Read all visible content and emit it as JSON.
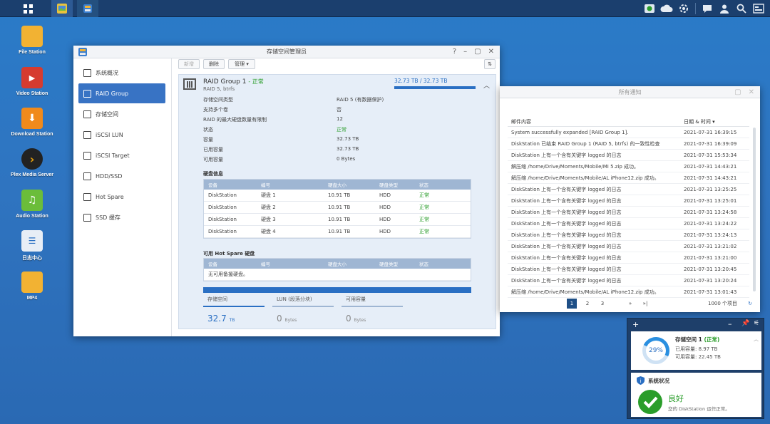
{
  "colors": {
    "accent": "#3873c4",
    "ok": "#2a9d2a",
    "taskbar": "#1b3f6e"
  },
  "desktop": [
    {
      "label": "File Station",
      "icon": "folder-icon",
      "color": "#f2b233"
    },
    {
      "label": "Video Station",
      "icon": "film-icon",
      "color": "#d63b2f"
    },
    {
      "label": "Download Station",
      "icon": "download-arrow-icon",
      "color": "#f08a1c"
    },
    {
      "label": "Plex Media Server",
      "icon": "plex-chevron-icon",
      "color": "#222222"
    },
    {
      "label": "Audio Station",
      "icon": "music-note-icon",
      "color": "#6bbd3a"
    },
    {
      "label": "日志中心",
      "icon": "log-document-icon",
      "color": "#e8eef6"
    },
    {
      "label": "MP4",
      "icon": "folder-icon",
      "color": "#f2b233"
    }
  ],
  "storage": {
    "title": "存储空间管理员",
    "sidebar": [
      "系统概况",
      "RAID Group",
      "存储空间",
      "iSCSI LUN",
      "iSCSI Target",
      "HDD/SSD",
      "Hot Spare",
      "SSD 缓存"
    ],
    "toolbar": {
      "new": "新增",
      "delete": "删除",
      "manage": "管理 ▾"
    },
    "raid": {
      "title": "RAID Group 1",
      "status": "- 正常",
      "sub": "RAID 5, btrfs",
      "capacity": "32.73 TB / 32.73 TB",
      "props": [
        {
          "k": "存储空间类型",
          "v": "RAID 5 (有数据保护)"
        },
        {
          "k": "支持多个卷",
          "v": "否"
        },
        {
          "k": "RAID 的最大硬盘数量有限制",
          "v": "12"
        },
        {
          "k": "状态",
          "v": "正常"
        },
        {
          "k": "容量",
          "v": "32.73 TB"
        },
        {
          "k": "已用容量",
          "v": "32.73 TB"
        },
        {
          "k": "可用容量",
          "v": "0 Bytes"
        }
      ]
    },
    "disk_info": {
      "title": "硬盘信息",
      "headers": [
        "设备",
        "编号",
        "硬盘大小",
        "硬盘类型",
        "状态"
      ],
      "rows": [
        [
          "DiskStation",
          "硬盘 1",
          "10.91 TB",
          "HDD",
          "正常"
        ],
        [
          "DiskStation",
          "硬盘 2",
          "10.91 TB",
          "HDD",
          "正常"
        ],
        [
          "DiskStation",
          "硬盘 3",
          "10.91 TB",
          "HDD",
          "正常"
        ],
        [
          "DiskStation",
          "硬盘 4",
          "10.91 TB",
          "HDD",
          "正常"
        ]
      ]
    },
    "hot_spare": {
      "title": "可用 Hot Spare 硬盘",
      "headers": [
        "设备",
        "编号",
        "硬盘大小",
        "硬盘类型",
        "状态"
      ],
      "empty": "无可用备援硬盘。"
    },
    "stats": [
      {
        "label": "存储空间",
        "value": "32.7",
        "unit": "TB"
      },
      {
        "label": "LUN (段落分块)",
        "value": "0",
        "unit": "Bytes"
      },
      {
        "label": "可用容量",
        "value": "0",
        "unit": "Bytes"
      }
    ]
  },
  "notifications": {
    "title": "所有通知",
    "col_content": "邮件内容",
    "col_time": "日期 & 时间 ▾",
    "rows": [
      [
        "System successfully expanded [RAID Group 1].",
        "2021-07-31 16:39:15"
      ],
      [
        "DiskStation 已结束 RAID Group 1 (RAID 5, btrfs) 的一致性检查",
        "2021-07-31 16:39:09"
      ],
      [
        "DiskStation 上有一个含有关键字 logged 的日志",
        "2021-07-31 15:53:34"
      ],
      [
        "解压缩 /home/Drive/Moments/Mobile/MI 5.zip 成功。",
        "2021-07-31 14:43:21"
      ],
      [
        "解压缩 /home/Drive/Moments/Mobile/AL iPhone12.zip 成功。",
        "2021-07-31 14:43:21"
      ],
      [
        "DiskStation 上有一个含有关键字 logged 的日志",
        "2021-07-31 13:25:25"
      ],
      [
        "DiskStation 上有一个含有关键字 logged 的日志",
        "2021-07-31 13:25:01"
      ],
      [
        "DiskStation 上有一个含有关键字 logged 的日志",
        "2021-07-31 13:24:58"
      ],
      [
        "DiskStation 上有一个含有关键字 logged 的日志",
        "2021-07-31 13:24:22"
      ],
      [
        "DiskStation 上有一个含有关键字 logged 的日志",
        "2021-07-31 13:24:13"
      ],
      [
        "DiskStation 上有一个含有关键字 logged 的日志",
        "2021-07-31 13:21:02"
      ],
      [
        "DiskStation 上有一个含有关键字 logged 的日志",
        "2021-07-31 13:21:00"
      ],
      [
        "DiskStation 上有一个含有关键字 logged 的日志",
        "2021-07-31 13:20:45"
      ],
      [
        "DiskStation 上有一个含有关键字 logged 的日志",
        "2021-07-31 13:20:24"
      ],
      [
        "解压缩 /home/Drive/Moments/Mobile/AL iPhone12.zip 成功。",
        "2021-07-31 13:01:43"
      ]
    ],
    "pages": [
      "1",
      "2",
      "3"
    ],
    "total": "1000 个项目"
  },
  "widget": {
    "volume_title": "存储空间 1",
    "volume_status": "(正常)",
    "percent": "29%",
    "percent_value": 29,
    "used": "已用容量: 8.97 TB",
    "free": "可用容量: 22.45 TB",
    "health_title": "系统状况",
    "health_status": "良好",
    "health_desc": "您的 DiskStation 运作正常。"
  }
}
